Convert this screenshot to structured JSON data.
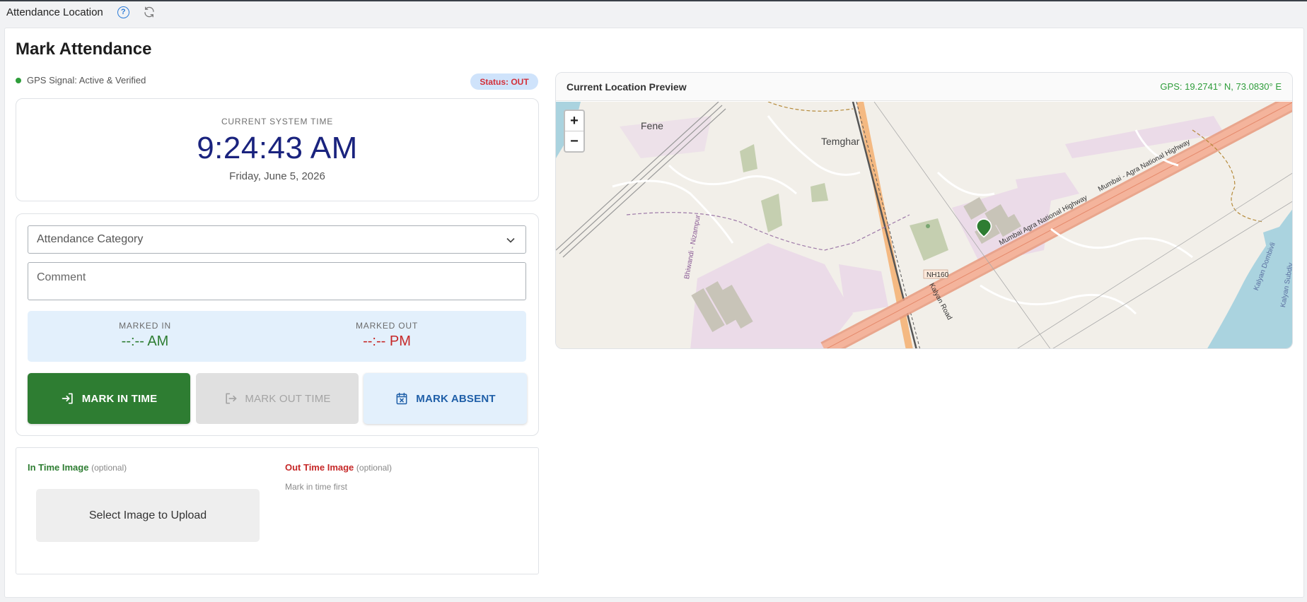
{
  "topbar": {
    "title": "Attendance Location",
    "help_icon": "question-circle-icon",
    "refresh_icon": "refresh-icon"
  },
  "page": {
    "title": "Mark Attendance"
  },
  "gps": {
    "signal_text": "GPS Signal: Active & Verified",
    "status_badge": "Status: OUT"
  },
  "clock": {
    "label": "CURRENT SYSTEM TIME",
    "time": "9:24:43 AM",
    "date": "Friday, June 5, 2026"
  },
  "form": {
    "category_placeholder": "Attendance Category",
    "comment_placeholder": "Comment"
  },
  "marked": {
    "in_label": "MARKED IN",
    "in_value": "--:-- AM",
    "out_label": "MARKED OUT",
    "out_value": "--:-- PM"
  },
  "buttons": {
    "mark_in": "MARK IN TIME",
    "mark_out": "MARK OUT TIME",
    "mark_absent": "MARK ABSENT"
  },
  "images": {
    "in_label": "In Time Image",
    "in_optional": "(optional)",
    "upload_label": "Select Image to Upload",
    "out_label": "Out Time Image",
    "out_optional": "(optional)",
    "out_note": "Mark in time first"
  },
  "map": {
    "title": "Current Location Preview",
    "gps_readout": "GPS: 19.2741° N, 73.0830° E",
    "zoom_in": "+",
    "zoom_out": "−",
    "labels": {
      "fene": "Fene",
      "temghar": "Temghar",
      "nh160": "NH160",
      "highway1": "Mumbai Agra National Highway",
      "highway2": "Mumbai - Agra National Highway",
      "nizampur": "Bhiwandi - Nizampur",
      "kalyan_road": "Kalyan Road",
      "dombivli": "Kalyan Dombivli",
      "subdivision": "Kalyan Subdiv"
    }
  },
  "colors": {
    "primary_green": "#2e7d32",
    "danger_red": "#c62828",
    "clock_navy": "#1a237e",
    "info_blue_bg": "#e3f0fc"
  }
}
